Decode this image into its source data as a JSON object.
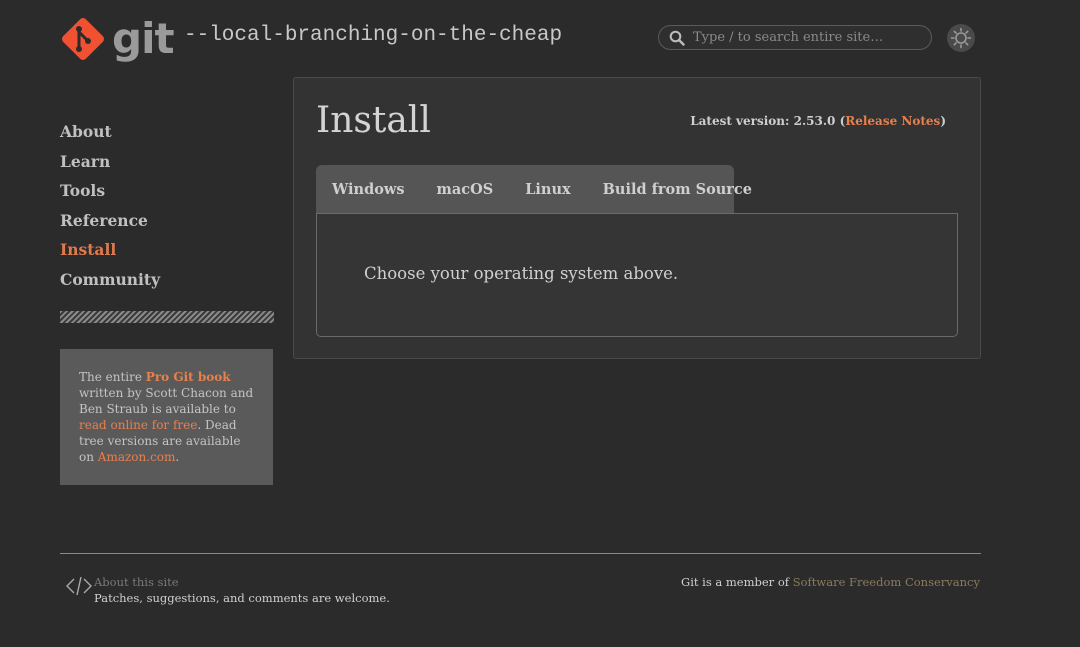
{
  "header": {
    "logo_text": "git",
    "tagline": "--local-branching-on-the-cheap",
    "search_placeholder": "Type / to search entire site…"
  },
  "sidebar": {
    "items": [
      {
        "label": "About"
      },
      {
        "label": "Learn"
      },
      {
        "label": "Tools"
      },
      {
        "label": "Reference"
      },
      {
        "label": "Install",
        "active": true
      },
      {
        "label": "Community"
      }
    ]
  },
  "book_box": {
    "t1": "The entire ",
    "link1": "Pro Git book",
    "t2": " written by Scott Chacon and Ben Straub is available to ",
    "link2": "read online for free",
    "t3": ". Dead tree versions are available on ",
    "link3": "Amazon.com",
    "t4": "."
  },
  "main": {
    "title": "Install",
    "latest_prefix": "Latest version: 2.53.0 (",
    "release_notes": "Release Notes",
    "latest_suffix": ")",
    "tabs": [
      {
        "label": "Windows"
      },
      {
        "label": "macOS"
      },
      {
        "label": "Linux"
      },
      {
        "label": "Build from Source"
      }
    ],
    "content": "Choose your operating system above."
  },
  "footer": {
    "about_link": "About this site",
    "patches": "Patches, suggestions, and comments are welcome.",
    "member_prefix": "Git is a member of ",
    "sfc_link": "Software Freedom Conservancy"
  },
  "colors": {
    "background": "#2b2b2b",
    "accent": "#e07a4d",
    "logo": "#f05133"
  },
  "icons": {
    "logo": "git-logo-icon",
    "search": "search-icon",
    "theme": "sun-icon",
    "footer": "code-icon"
  }
}
